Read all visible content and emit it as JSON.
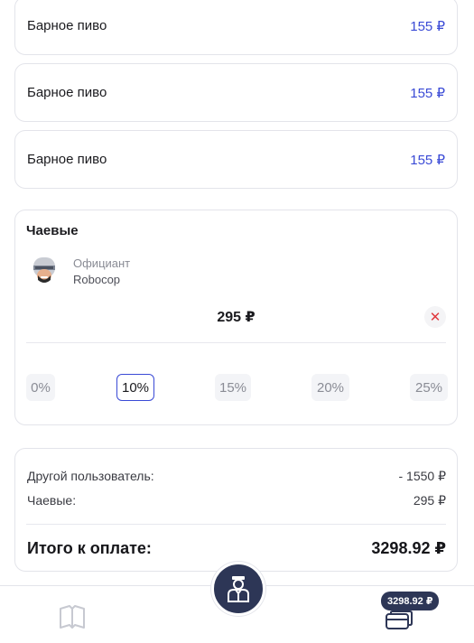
{
  "items": [
    {
      "name": "Барное пиво",
      "price": "155 ₽"
    },
    {
      "name": "Барное пиво",
      "price": "155 ₽"
    },
    {
      "name": "Барное пиво",
      "price": "155 ₽"
    }
  ],
  "tips": {
    "title": "Чаевые",
    "waiter_role": "Официант",
    "waiter_name": "Robocop",
    "amount": "295 ₽",
    "clear_icon": "close-icon",
    "percents": [
      "0%",
      "10%",
      "15%",
      "20%",
      "25%"
    ],
    "selected_percent": "10%"
  },
  "summary": {
    "other_user_label": "Другой пользователь:",
    "other_user_value": "- 1550 ₽",
    "tips_label": "Чаевые:",
    "tips_value": "295 ₽",
    "total_label": "Итого к оплате:",
    "total_value": "3298.92 ₽"
  },
  "bottom_nav": {
    "menu_icon": "book-icon",
    "center_icon": "waiter-icon",
    "pay_badge": "3298.92 ₽",
    "pay_icon": "credit-card-icon"
  },
  "colors": {
    "accent": "#3a4ad6",
    "dark": "#2d3656",
    "danger": "#e0393e"
  }
}
